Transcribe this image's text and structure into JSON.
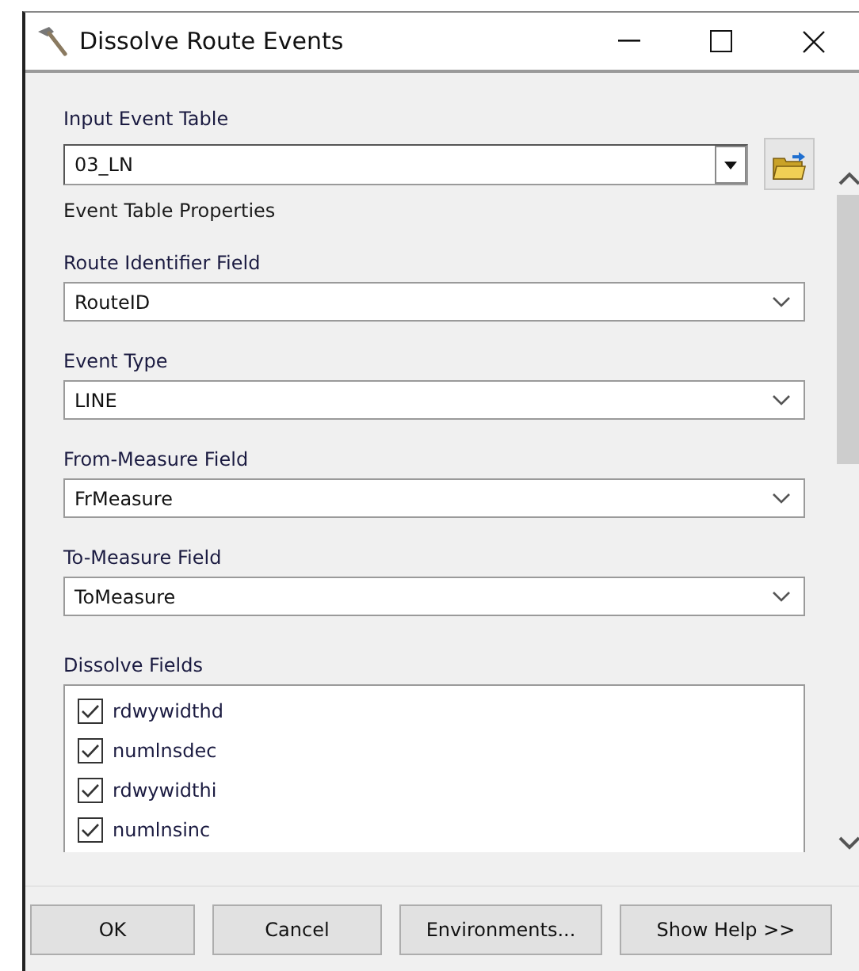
{
  "window": {
    "title": "Dissolve Route Events"
  },
  "fields": [
    {
      "kind": "combo",
      "label": "Input Event Table",
      "value": "03_LN"
    },
    {
      "kind": "heading",
      "label": "Event Table Properties"
    },
    {
      "kind": "select",
      "label": "Route Identifier Field",
      "value": "RouteID"
    },
    {
      "kind": "select",
      "label": "Event Type",
      "value": "LINE"
    },
    {
      "kind": "select",
      "label": "From-Measure Field",
      "value": "FrMeasure"
    },
    {
      "kind": "select",
      "label": "To-Measure Field",
      "value": "ToMeasure"
    }
  ],
  "dissolve_fields": {
    "label": "Dissolve Fields",
    "items": [
      {
        "name": "rdwywidthd",
        "checked": true
      },
      {
        "name": "numlnsdec",
        "checked": true
      },
      {
        "name": "rdwywidthi",
        "checked": true
      },
      {
        "name": "numlnsinc",
        "checked": true
      }
    ]
  },
  "buttons": [
    "OK",
    "Cancel",
    "Environments...",
    "Show Help >>"
  ]
}
